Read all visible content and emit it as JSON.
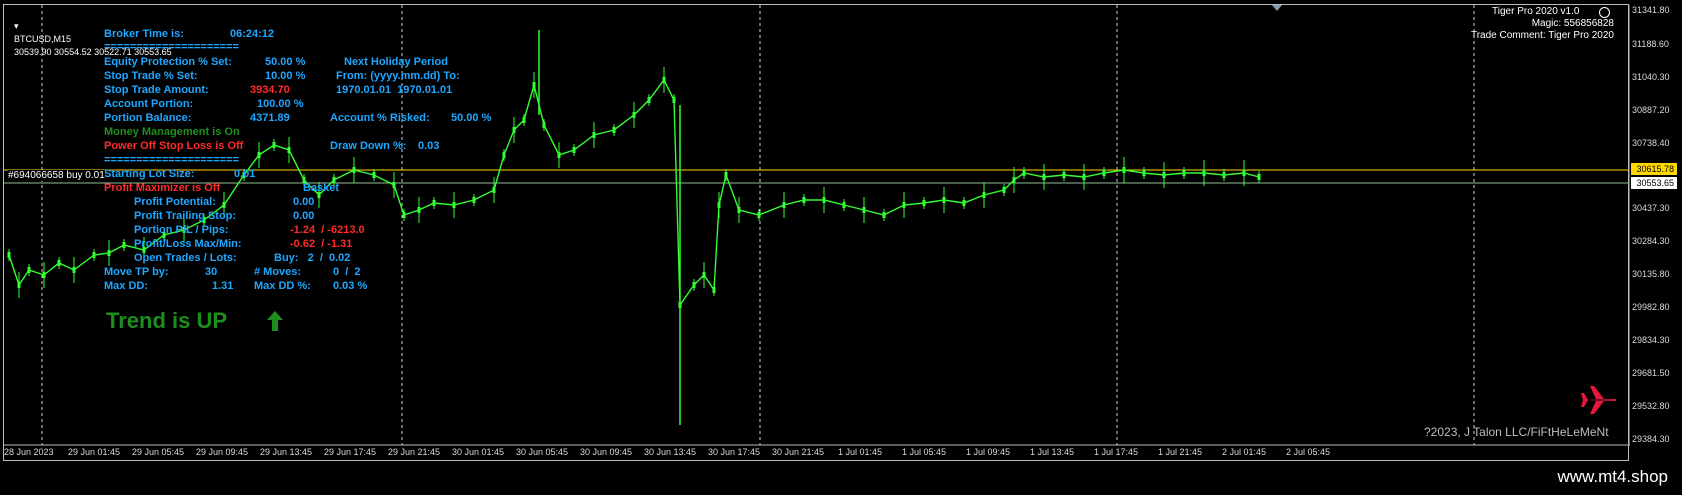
{
  "symbol_header": {
    "title": "BTCUSD,M15",
    "ohlc": "30539.90 30554.52 30522.71 30553.65"
  },
  "ea_info": {
    "name": "Tiger Pro 2020 v1.0",
    "magic": "Magic: 556856828",
    "trade_comment": "Trade Comment: Tiger Pro 2020"
  },
  "panel": {
    "broker_time_label": "Broker Time is:",
    "broker_time_value": "06:24:12",
    "separator": "=====================",
    "equity_protection_label": "Equity Protection % Set:",
    "equity_protection_value": "50.00 %",
    "next_holiday_label": "Next Holiday Period",
    "stop_trade_label": "Stop Trade % Set:",
    "stop_trade_value": "10.00 %",
    "holiday_format": "From: (yyyy.mm.dd) To:",
    "stop_trade_amount_label": "Stop Trade Amount:",
    "stop_trade_amount_value": "3934.70",
    "holiday_dates": "1970.01.01  1970.01.01",
    "account_portion_label": "Account Portion:",
    "account_portion_value": "100.00 %",
    "portion_balance_label": "Portion Balance:",
    "portion_balance_value": "4371.89",
    "account_risked_label": "Account % Risked:",
    "account_risked_value": "50.00 %",
    "money_management": "Money Management is On",
    "power_off": "Power Off Stop Loss is Off",
    "drawdown_label": "Draw Down %:",
    "drawdown_value": "0.03",
    "separator2": "=====================",
    "starting_lot_label": "Starting Lot Size:",
    "starting_lot_value": "0.01",
    "profit_maximizer": "Profit Maximizer is Off",
    "basket_label": "Basket",
    "profit_potential_label": "Profit Potential:",
    "profit_potential_value": "0.00",
    "profit_trailing_label": "Profit Trailing Stop:",
    "profit_trailing_value": "0.00",
    "portion_pl_label": "Portion P/L / Pips:",
    "portion_pl_value": "-1.24  / -6213.0",
    "profit_loss_label": "Profit/Loss Max/Min:",
    "profit_loss_value": "-0.62  / -1.31",
    "open_trades_label": "Open Trades / Lots:",
    "open_trades_value": "Buy:   2  /  0.02",
    "move_tp_label": "Move TP by:",
    "move_tp_value": "30",
    "moves_label": "# Moves:",
    "moves_value": "0  /  2",
    "max_dd_label": "Max DD:",
    "max_dd_value": "1.31",
    "max_dd_pct_label": "Max DD %:",
    "max_dd_pct_value": "0.03 %"
  },
  "trend": {
    "text": "Trend is UP",
    "icon": "arrow-up-icon"
  },
  "order_label": "#694066658 buy 0.01",
  "price_axis": {
    "labels": [
      "31341.80",
      "31188.60",
      "31040.30",
      "30887.20",
      "30738.40",
      "30437.30",
      "30284.30",
      "30135.80",
      "29982.80",
      "29834.30",
      "29681.50",
      "29532.80",
      "29384.30"
    ],
    "tp_line_value": "30615.78",
    "current_price": "30553.65"
  },
  "time_axis": {
    "labels": [
      "28 Jun 2023",
      "29 Jun 01:45",
      "29 Jun 05:45",
      "29 Jun 09:45",
      "29 Jun 13:45",
      "29 Jun 17:45",
      "29 Jun 21:45",
      "30 Jun 01:45",
      "30 Jun 05:45",
      "30 Jun 09:45",
      "30 Jun 13:45",
      "30 Jun 17:45",
      "30 Jun 21:45",
      "1 Jul 01:45",
      "1 Jul 05:45",
      "1 Jul 09:45",
      "1 Jul 13:45",
      "1 Jul 17:45",
      "1 Jul 21:45",
      "2 Jul 01:45",
      "2 Jul 05:45"
    ]
  },
  "copyright": "?2023, J Talon LLC/FiFtHeLeMeNt",
  "site": "www.mt4.shop",
  "colors": {
    "background": "#000000",
    "candles": "#33ff33",
    "tp_line": "#ffd700",
    "price_line": "#8fbc8f",
    "panel_text": "#1ea7ff",
    "loss_text": "#ff2b2b",
    "ok_text": "#1e8f1e",
    "plane": "#e8163c"
  }
}
